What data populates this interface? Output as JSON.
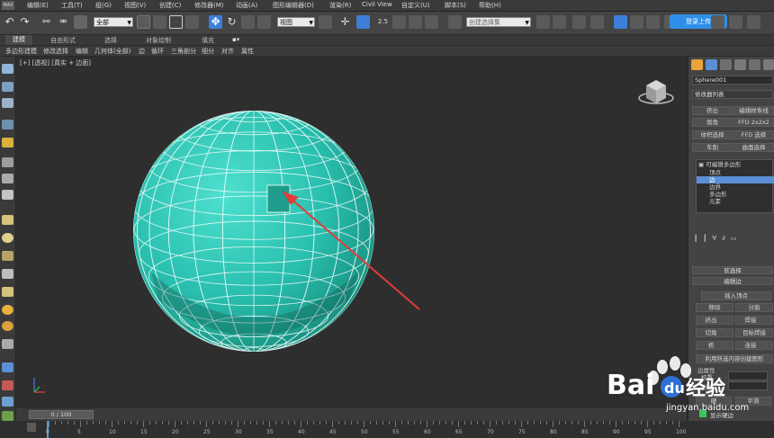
{
  "menubar": {
    "logo": "MAX",
    "items": [
      "编辑(E)",
      "工具(T)",
      "组(G)",
      "视图(V)",
      "创建(C)",
      "修改器(M)",
      "动画(A)",
      "图形编辑器(D)",
      "渲染(R)",
      "Civil View",
      "自定义(U)",
      "脚本(S)",
      "帮助(H)"
    ]
  },
  "toolbar": {
    "filter_select": "全部",
    "view_select": "视图",
    "selection_set_placeholder": "创建选择集",
    "snap_label": "2.5",
    "login_label": "登录上传"
  },
  "ribbon": {
    "tabs": [
      "建模",
      "自由形式",
      "选择",
      "对象绘制",
      "填充"
    ],
    "subtabs": [
      "多边形建模",
      "修改选择",
      "编辑",
      "几何体(全部)",
      "边",
      "循环",
      "三角剖分",
      "细分",
      "对齐",
      "属性"
    ]
  },
  "viewport": {
    "label": "[+] [透视] [真实 + 边面]"
  },
  "panel": {
    "object_name": "Sphere001",
    "modifier_list_label": "修改器列表",
    "modifier_buttons": [
      [
        "挤出",
        "编辑样条线"
      ],
      [
        "倒角",
        "FFD 2x2x2"
      ],
      [
        "体积选择",
        "FFD 选择"
      ],
      [
        "车削",
        "曲面选择"
      ]
    ],
    "stack": {
      "root": "可编辑多边形",
      "items": [
        "顶点",
        "边",
        "边界",
        "多边形",
        "元素"
      ],
      "selected": "边"
    },
    "rollouts": {
      "soft_select": "软选择",
      "edit_edges": "编辑边",
      "insert_vertex": "插入顶点",
      "remove": "移除",
      "split": "分割",
      "extrude": "挤出",
      "weld": "焊接",
      "chamfer": "切角",
      "target_weld": "目标焊接",
      "bridge": "桥",
      "connect": "连接",
      "create_shape": "利用所选内容创建图形",
      "edge_properties": "边属性",
      "weight": "权重",
      "crease": "折缝",
      "hard": "硬",
      "smooth": "平滑",
      "show_hard_edges": "显示硬边"
    }
  },
  "timeline": {
    "frame_display": "0 / 100",
    "ticks": [
      "0",
      "5",
      "10",
      "15",
      "20",
      "25",
      "30",
      "35",
      "40",
      "45",
      "50",
      "55",
      "60",
      "65",
      "70",
      "75",
      "80",
      "85",
      "90",
      "95",
      "100"
    ]
  },
  "watermark": {
    "brand": "Bai",
    "brand_suffix": "经验",
    "url": "jingyan.baidu.com"
  }
}
